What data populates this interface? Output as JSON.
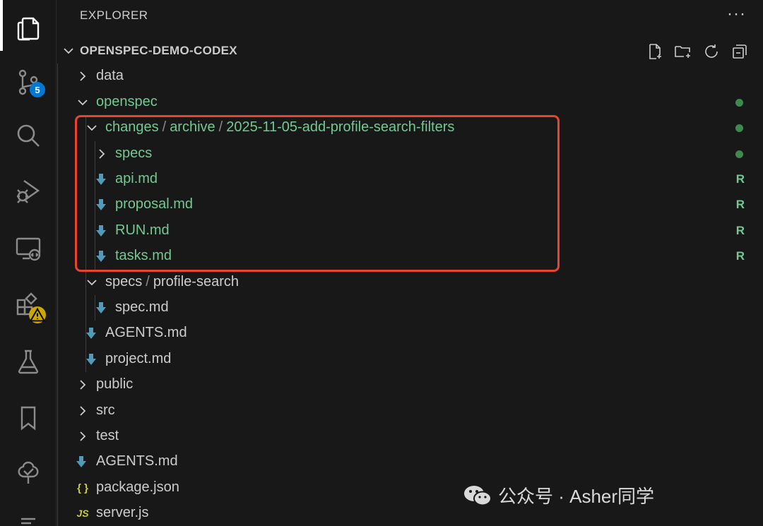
{
  "activity_bar": {
    "items": [
      {
        "name": "explorer-icon"
      },
      {
        "name": "source-control-icon",
        "badge": "5"
      },
      {
        "name": "search-icon"
      },
      {
        "name": "run-debug-icon"
      },
      {
        "name": "remote-explorer-icon"
      },
      {
        "name": "extensions-icon",
        "warning": true
      },
      {
        "name": "testing-icon"
      },
      {
        "name": "bookmarks-icon"
      },
      {
        "name": "timeline-icon"
      }
    ]
  },
  "sidebar": {
    "title": "EXPLORER",
    "more": "···",
    "section_title": "OPENSPEC-DEMO-CODEX",
    "actions": [
      "new-file-icon",
      "new-folder-icon",
      "refresh-icon",
      "collapse-all-icon"
    ]
  },
  "tree": {
    "data": "data",
    "openspec": "openspec",
    "changes": "changes",
    "archive": "archive",
    "archive_folder": "2025-11-05-add-profile-search-filters",
    "specs_archived": "specs",
    "api_md": "api.md",
    "proposal_md": "proposal.md",
    "run_md": "RUN.md",
    "tasks_md": "tasks.md",
    "specs": "specs",
    "profile_search": "profile-search",
    "spec_md": "spec.md",
    "agents_md_inner": "AGENTS.md",
    "project_md": "project.md",
    "public": "public",
    "src": "src",
    "test": "test",
    "agents_md": "AGENTS.md",
    "package_json": "package.json",
    "server_js": "server.js",
    "decoration_renamed": "R",
    "json_icon": "{ }",
    "js_icon": "JS"
  },
  "colors": {
    "modified_green": "#73c991",
    "highlight_border": "#e8452c",
    "markdown_blue": "#519aba",
    "json_yellow": "#cbcb41"
  },
  "watermark": {
    "text": "公众号 · Asher同学"
  }
}
